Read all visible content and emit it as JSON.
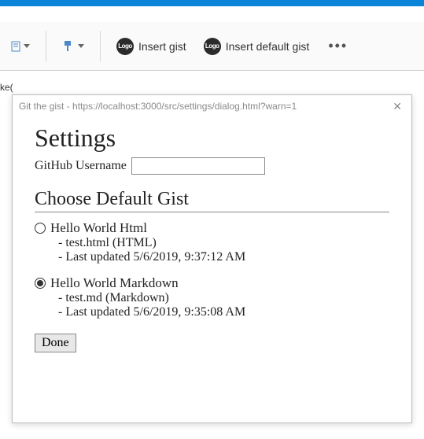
{
  "ribbon": {
    "insert_gist_label": "Insert gist",
    "insert_default_gist_label": "Insert default gist",
    "logo_text": "Logo"
  },
  "edge_text": "ke(",
  "dialog": {
    "title": "Git the gist - https://localhost:3000/src/settings/dialog.html?warn=1",
    "heading": "Settings",
    "username_label": "GitHub Username",
    "username_value": "",
    "choose_heading": "Choose Default Gist",
    "options": [
      {
        "label": "Hello World Html",
        "file": "- test.html (HTML)",
        "updated": "- Last updated 5/6/2019, 9:37:12 AM",
        "checked": false
      },
      {
        "label": "Hello World Markdown",
        "file": "- test.md (Markdown)",
        "updated": "- Last updated 5/6/2019, 9:35:08 AM",
        "checked": true
      }
    ],
    "done_label": "Done"
  }
}
